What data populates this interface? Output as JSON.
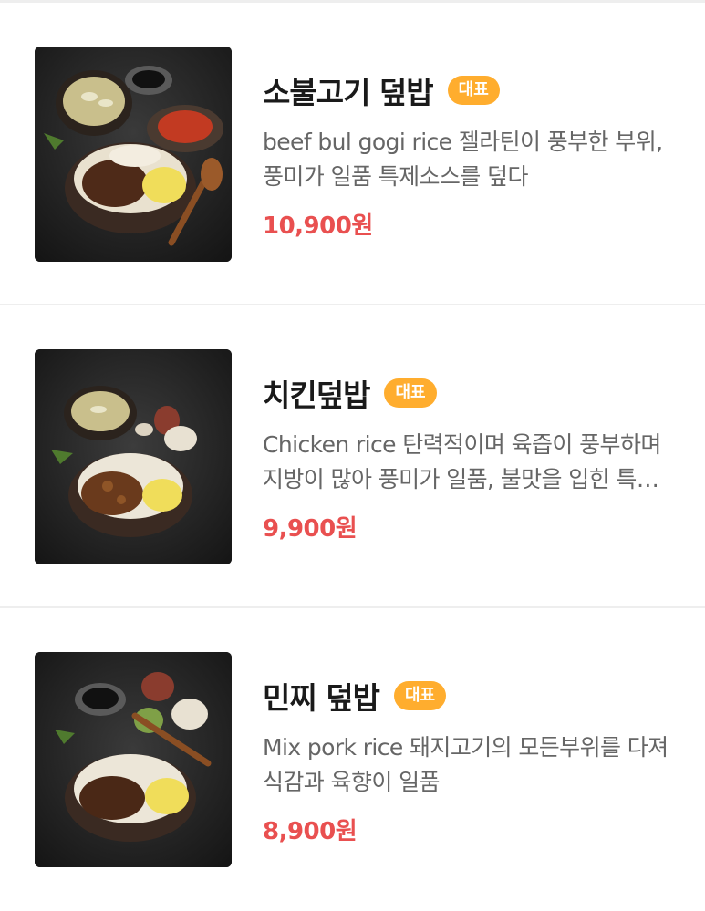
{
  "menu": {
    "items": [
      {
        "name": "소불고기 덮밥",
        "badge": "대표",
        "description": "beef bul gogi rice 젤라틴이 풍부한 부위, 풍미가 일품 특제소스를 덮다",
        "price": "10,900원",
        "image": "beef-bulgogi-rice-bowl-photo"
      },
      {
        "name": "치킨덮밥",
        "badge": "대표",
        "description": "Chicken rice 탄력적이며 육즙이 풍부하며 지방이 많아 풍미가 일품, 불맛을 입힌 특제소스를 덮다",
        "price": "9,900원",
        "image": "chicken-rice-bowl-photo"
      },
      {
        "name": "민찌 덮밥",
        "badge": "대표",
        "description": "Mix pork rice 돼지고기의 모든부위를 다져 식감과 육향이 일품",
        "price": "8,900원",
        "image": "minced-pork-rice-bowl-photo"
      }
    ]
  },
  "colors": {
    "badge": "#ffad2e",
    "price": "#e95050",
    "divider": "#eeeeee"
  }
}
